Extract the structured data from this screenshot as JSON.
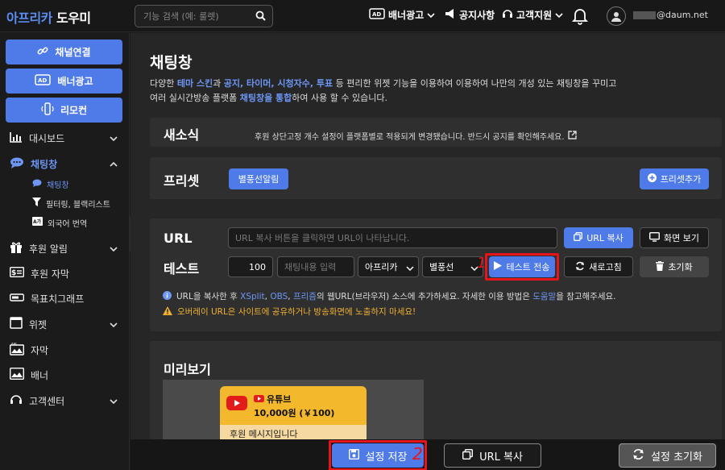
{
  "brand": {
    "part1": "아프리카",
    "part2": "도우미"
  },
  "search": {
    "placeholder": "기능 검색 (예: 룰렛)"
  },
  "topnav": {
    "banner_ad": "배너광고",
    "notice": "공지사항",
    "support": "고객지원",
    "email_suffix": "@daum.net"
  },
  "sidebar": {
    "buttons": [
      "채널연결",
      "배너광고",
      "리모컨"
    ],
    "items": [
      {
        "label": "대시보드"
      },
      {
        "label": "채팅창"
      },
      {
        "label": "후원 알림"
      },
      {
        "label": "후원 자막"
      },
      {
        "label": "목표치그래프"
      },
      {
        "label": "위젯"
      },
      {
        "label": "자막"
      },
      {
        "label": "배너"
      },
      {
        "label": "고객센터"
      }
    ],
    "sub_items": [
      "채팅창",
      "필터링, 블랙리스트",
      "외국어 번역"
    ]
  },
  "page": {
    "title": "채팅창",
    "intro": {
      "p1": "다양한 ",
      "b1": "테마 스킨",
      "p2": "과 ",
      "b2": "공지, 타이머, 시청자수, 투표",
      "p3": " 등 편리한 위젯 기능을 이용하여 이용하여 나만의 개성 있는 채팅창을 꾸미고",
      "p4": "여러 실시간방송 플랫폼 ",
      "b3": "채팅창을 통합",
      "p5": "하여 사용 할 수 있습니다."
    }
  },
  "news": {
    "title": "새소식",
    "text": "후원 상단고정 개수 설정이 플랫폼별로 적용되게 변경됐습니다. 반드시 공지를 확인해주세요."
  },
  "preset": {
    "title": "프리셋",
    "chip": "별풍선알림",
    "add_button": "프리셋추가"
  },
  "url": {
    "label": "URL",
    "placeholder": "URL 복사 버튼을 클릭하면 URL이 나타납니다.",
    "copy_button": "URL 복사",
    "view_button": "화면 보기"
  },
  "test": {
    "label": "테스트",
    "amount": "100",
    "message_placeholder": "채팅내용 입력",
    "platform": "아프리카",
    "type": "별풍선",
    "send_button": "테스트 전송",
    "refresh_button": "새로고침",
    "reset_button": "초기화",
    "marker": "1"
  },
  "info": {
    "line1_a": "URL을 복사한 후 ",
    "line1_xsplit": "XSplit",
    "line1_sep1": ", ",
    "line1_obs": "OBS",
    "line1_sep2": ", ",
    "line1_prism": "프리즘",
    "line1_b": "의 웹URL(브라우저) 소스에 추가하세요. 자세한 이용 방법은 ",
    "line1_help": "도움말",
    "line1_c": "을 참고해주세요.",
    "line2": "오버레이 URL은 사이트에 공유하거나 방송화면에 노출하지 마세요!"
  },
  "preview": {
    "title": "미리보기",
    "alert_source": "유튜브",
    "alert_amount": "10,000원 (￥100)",
    "alert_message": "후원 메시지입니다"
  },
  "bottom": {
    "save_button": "설정 저장",
    "marker": "2",
    "copy_url_button": "URL 복사",
    "reset_button": "설정 초기화"
  },
  "colors": {
    "accent": "#4e7be8",
    "highlight": "#e8141c",
    "warning": "#f0b030",
    "alert_bg": "#f3b82b"
  }
}
